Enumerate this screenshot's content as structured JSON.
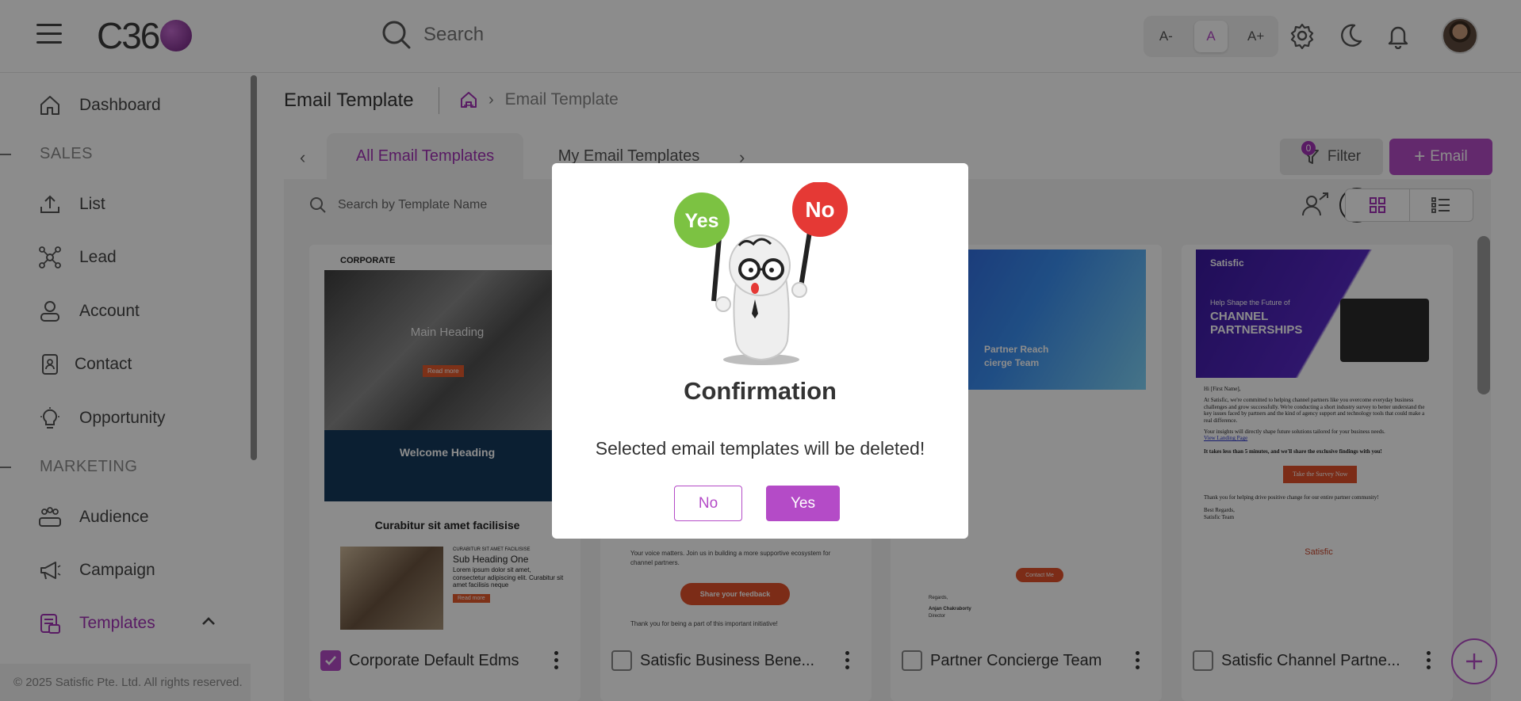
{
  "header": {
    "logo_text": "C36",
    "search_placeholder": "Search",
    "font_controls": [
      "A-",
      "A",
      "A+"
    ],
    "icons": [
      "search-icon",
      "gear-icon",
      "moon-icon",
      "bell-icon"
    ]
  },
  "sidebar": {
    "items": [
      {
        "label": "Dashboard",
        "icon": "home-icon"
      },
      {
        "label": "List",
        "icon": "upload-icon"
      },
      {
        "label": "Lead",
        "icon": "network-icon"
      },
      {
        "label": "Account",
        "icon": "account-icon"
      },
      {
        "label": "Contact",
        "icon": "contact-icon"
      },
      {
        "label": "Opportunity",
        "icon": "bulb-icon"
      },
      {
        "label": "Audience",
        "icon": "audience-icon"
      },
      {
        "label": "Campaign",
        "icon": "megaphone-icon"
      },
      {
        "label": "Templates",
        "icon": "templates-icon"
      }
    ],
    "sections": [
      "SALES",
      "MARKETING"
    ],
    "footer": "© 2025 Satisfic Pte. Ltd. All rights reserved."
  },
  "page": {
    "title": "Email Template",
    "breadcrumb_current": "Email Template",
    "tabs": [
      "All Email Templates",
      "My Email Templates"
    ],
    "filter_label": "Filter",
    "filter_count": "0",
    "add_label": "Email",
    "template_search_placeholder": "Search by Template Name"
  },
  "cards": [
    {
      "name": "Corporate Default Edms",
      "checked": true,
      "preview": {
        "brand": "CORPORATE",
        "heading": "Main Heading",
        "btn": "Read more",
        "welcome": "Welcome Heading",
        "sub": "Curabitur sit amet facilisise",
        "small_caps": "CURABITUR SIT AMET FACILISISE",
        "sub_heading": "Sub Heading One",
        "body": "Lorem ipsum dolor sit amet, consectetur adipiscing elit. Curabitur sit amet facilisis neque",
        "btn2": "Read more"
      }
    },
    {
      "name": "Satisfic Business Bene...",
      "checked": false,
      "preview": {
        "line1": "Your voice matters. Join us in building a more supportive ecosystem for channel partners.",
        "btn": "Share your feedback",
        "line2": "Thank you for being a part of this important initiative!"
      }
    },
    {
      "name": "Partner Concierge Team",
      "checked": false,
      "preview": {
        "hero_line1": "Partner Reach",
        "hero_line2": "cierge Team",
        "btn": "Contact Me",
        "sign_regards": "Regards,",
        "sign_name": "Anjan Chakraborty",
        "sign_title": "Director"
      }
    },
    {
      "name": "Satisfic Channel Partne...",
      "checked": false,
      "preview": {
        "brand": "Satisfic",
        "hero_small": "Help Shape the Future of",
        "hero_big1": "CHANNEL",
        "hero_big2": "PARTNERSHIPS",
        "greet": "Hi [First Name],",
        "para1": "At Satisfic, we're committed to helping channel partners like you overcome everyday business challenges and grow successfully. We're conducting a short industry survey to better understand the key issues faced by partners and the kind of agency support and technology tools that could make a real difference.",
        "para2": "Your insights will directly shape future solutions tailored for your business needs.",
        "link": "View Landing Page",
        "bold": "It takes less than 5 minutes, and we'll share the exclusive findings with you!",
        "btn": "Take the Survey Now",
        "thanks": "Thank you for helping drive positive change for our entire partner community!",
        "regards": "Best Regards,",
        "team": "Satisfic Team",
        "foot_brand": "Satisfic"
      }
    }
  ],
  "modal": {
    "sign_yes": "Yes",
    "sign_no": "No",
    "title": "Confirmation",
    "message": "Selected email templates will be deleted!",
    "no_label": "No",
    "yes_label": "Yes"
  }
}
